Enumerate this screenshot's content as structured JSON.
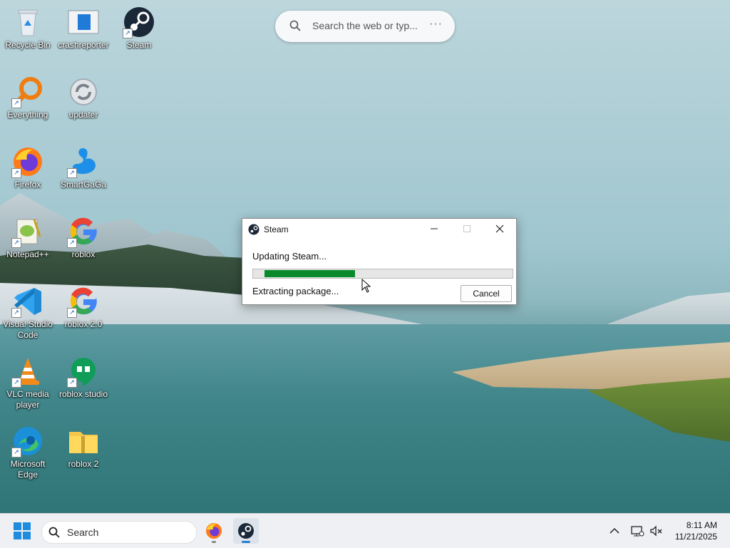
{
  "web_search": {
    "placeholder": "Search the web or typ...",
    "more": "···"
  },
  "desktop_icons": [
    {
      "label": "Recycle Bin"
    },
    {
      "label": "crashreporter"
    },
    {
      "label": "Steam"
    },
    {
      "label": "Everything"
    },
    {
      "label": "updater"
    },
    {
      "label": "Firefox"
    },
    {
      "label": "SmartGaGa"
    },
    {
      "label": "Notepad++"
    },
    {
      "label": "roblox"
    },
    {
      "label": "Visual Studio Code"
    },
    {
      "label": "roblox 2.0"
    },
    {
      "label": "VLC media player"
    },
    {
      "label": "roblox studio"
    },
    {
      "label": "Microsoft Edge"
    },
    {
      "label": "roblox 2"
    }
  ],
  "dialog": {
    "title": "Steam",
    "status_top": "Updating Steam...",
    "status_bottom": "Extracting package...",
    "cancel_label": "Cancel",
    "progress_fraction": 0.35
  },
  "taskbar": {
    "search_placeholder": "Search",
    "time": "8:11 AM",
    "date": "11/21/2025"
  },
  "colors": {
    "progress_green": "#0a8a2a",
    "taskbar_bg": "#eef0f4",
    "steam_blue": "#1b2838"
  }
}
